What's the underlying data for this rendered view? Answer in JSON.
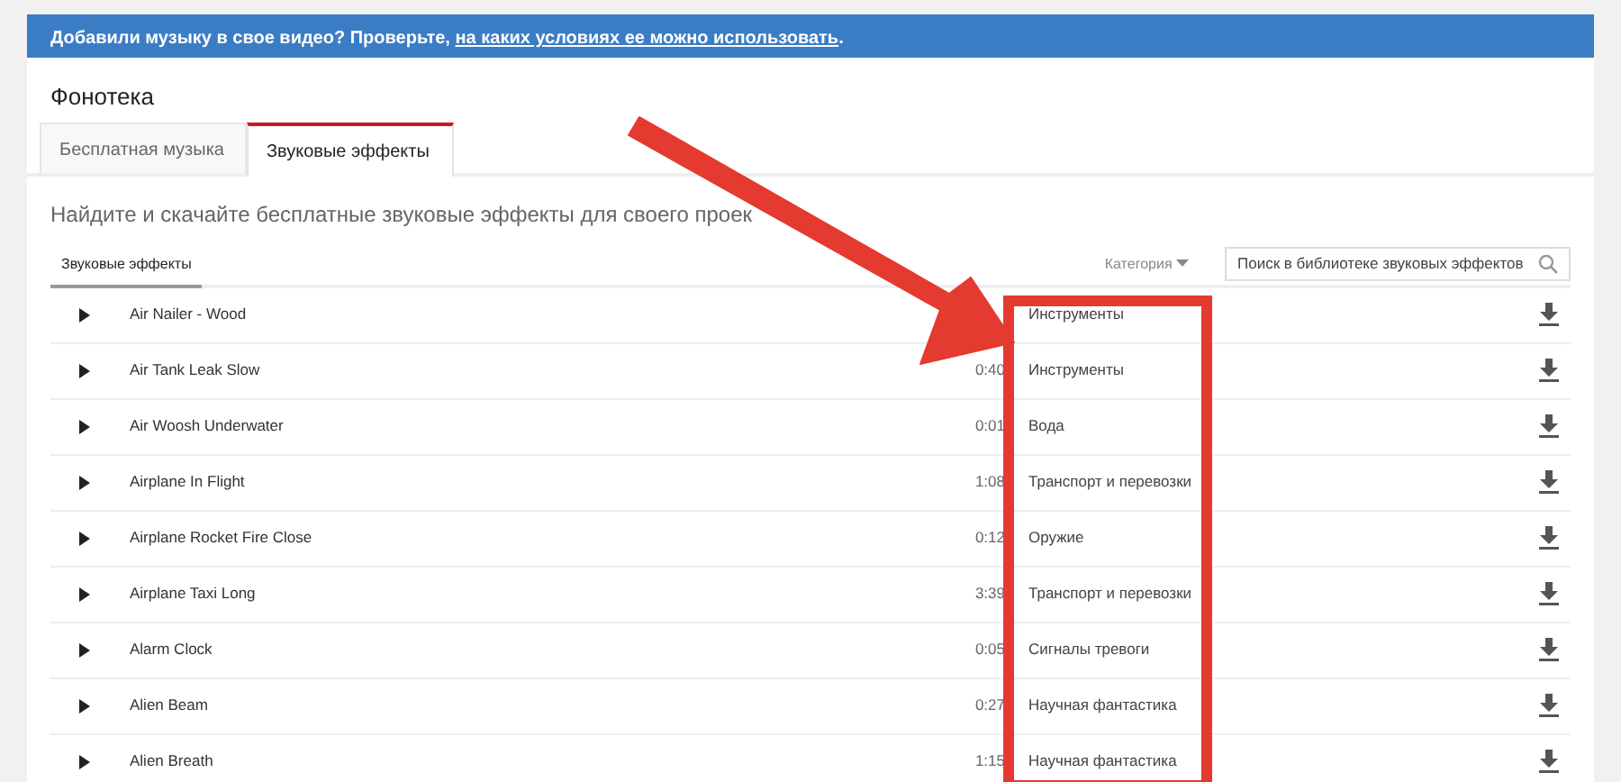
{
  "notice": {
    "text": "Добавили музыку в свое видео? Проверьте, ",
    "link": "на каких условиях ее можно использовать",
    "end": "."
  },
  "title": "Фонотека",
  "tabs": [
    {
      "label": "Бесплатная музыка",
      "selected": false
    },
    {
      "label": "Звуковые эффекты",
      "selected": true
    }
  ],
  "heading": "Найдите и скачайте бесплатные звуковые эффекты для своего проек",
  "subtab": {
    "label": "Звуковые эффекты",
    "selected": true
  },
  "category_filter": {
    "label": "Категория"
  },
  "search": {
    "placeholder": "Поиск в библиотеке звуковых эффектов"
  },
  "tracks": [
    {
      "title": "Air Nailer - Wood",
      "category": "Инструменты"
    },
    {
      "title": "Air Tank Leak Slow",
      "duration": "0:40",
      "category": "Инструменты"
    },
    {
      "title": "Air Woosh Underwater",
      "duration": "0:01",
      "category": "Вода"
    },
    {
      "title": "Airplane In Flight",
      "duration": "1:08",
      "category": "Транспорт и перевозки"
    },
    {
      "title": "Airplane Rocket Fire Close",
      "duration": "0:12",
      "category": "Оружие"
    },
    {
      "title": "Airplane Taxi Long",
      "duration": "3:39",
      "category": "Транспорт и перевозки"
    },
    {
      "title": "Alarm Clock",
      "duration": "0:05",
      "category": "Сигналы тревоги"
    },
    {
      "title": "Alien Beam",
      "duration": "0:27",
      "category": "Научная фантастика"
    },
    {
      "title": "Alien Breath",
      "duration": "1:15",
      "category": "Научная фантастика"
    }
  ]
}
